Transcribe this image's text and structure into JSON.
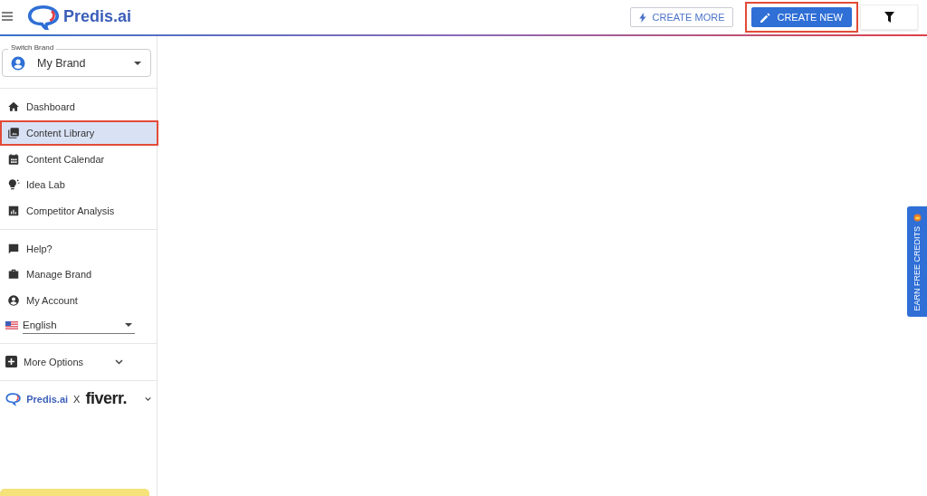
{
  "header": {
    "logo_text": "Predis.ai",
    "buttons": [
      {
        "label": "CREATE MORE",
        "kind": "outline",
        "annotated": false
      },
      {
        "label": "CREATE NEW",
        "kind": "primary",
        "annotated": true
      }
    ]
  },
  "brand_switch": {
    "label": "Switch Brand",
    "value": "My Brand"
  },
  "nav_groups": [
    [
      {
        "label": "Dashboard",
        "kind": "home",
        "selected": false,
        "annotated": false
      },
      {
        "label": "Content Library",
        "kind": "library",
        "selected": true,
        "annotated": true
      },
      {
        "label": "Content Calendar",
        "kind": "calendar",
        "selected": false,
        "annotated": false
      },
      {
        "label": "Idea Lab",
        "kind": "bulb",
        "selected": false,
        "annotated": false
      },
      {
        "label": "Competitor Analysis",
        "kind": "chart",
        "selected": false,
        "annotated": false
      }
    ],
    [
      {
        "label": "Help?",
        "kind": "chat",
        "selected": false,
        "annotated": false
      },
      {
        "label": "Manage Brand",
        "kind": "briefcase",
        "selected": false,
        "annotated": false
      },
      {
        "label": "My Account",
        "kind": "account",
        "selected": false,
        "annotated": false
      }
    ]
  ],
  "language": {
    "value": "English"
  },
  "more_options": {
    "label": "More Options",
    "expanded": false
  },
  "partner": {
    "logo_text": "Predis.ai",
    "separator": "X",
    "partner_text": "fiverr."
  },
  "earn_tab": {
    "label": "EARN FREE CREDITS"
  }
}
